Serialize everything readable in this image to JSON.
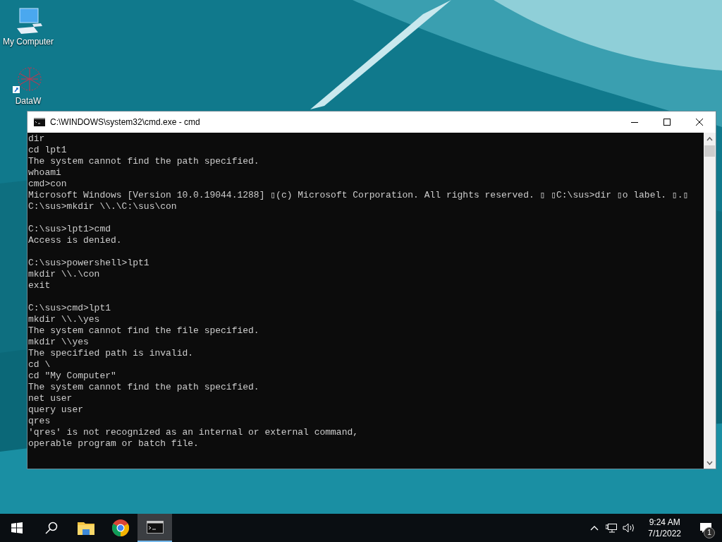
{
  "desktop": {
    "icons": [
      {
        "label": "My Computer",
        "kind": "computer"
      },
      {
        "label": "DataW",
        "kind": "shortcut"
      }
    ]
  },
  "window": {
    "title": "C:\\WINDOWS\\system32\\cmd.exe - cmd",
    "blocks": [
      {
        "lines": [
          "dir",
          "cd lpt1",
          "The system cannot find the path specified.",
          "whoami",
          "cmd>con",
          "Microsoft Windows [Version 10.0.19044.1288] ▯(c) Microsoft Corporation. All rights reserved. ▯ ▯C:\\sus>dir ▯o label. ▯.▯",
          "C:\\sus>mkdir \\\\.\\C:\\sus\\con"
        ]
      },
      {
        "lines": [
          "C:\\sus>lpt1>cmd",
          "Access is denied."
        ]
      },
      {
        "lines": [
          "C:\\sus>powershell>lpt1",
          "mkdir \\\\.\\con",
          "exit"
        ]
      },
      {
        "lines": [
          "C:\\sus>cmd>lpt1",
          "mkdir \\\\.\\yes",
          "The system cannot find the file specified.",
          "mkdir \\\\yes",
          "The specified path is invalid.",
          "cd \\",
          "cd \"My Computer\"",
          "The system cannot find the path specified.",
          "net user",
          "query user",
          "qres",
          "'qres' is not recognized as an internal or external command,",
          "operable program or batch file."
        ]
      }
    ]
  },
  "taskbar": {
    "apps": [
      {
        "kind": "search",
        "selected": false
      },
      {
        "kind": "folder",
        "selected": false
      },
      {
        "kind": "browser",
        "selected": false
      },
      {
        "kind": "terminal",
        "selected": true
      }
    ],
    "time": "9:24 AM",
    "date": "7/1/2022",
    "notification_count": "1"
  }
}
